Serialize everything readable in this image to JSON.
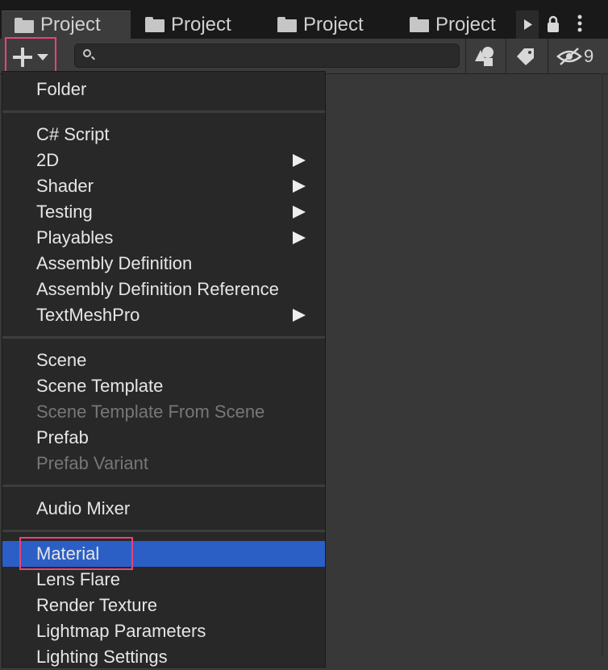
{
  "tabs": [
    {
      "label": "Project"
    },
    {
      "label": "Project"
    },
    {
      "label": "Project"
    },
    {
      "label": "Project"
    }
  ],
  "toolbar": {
    "search_value": "",
    "hidden_count": "9"
  },
  "menu": {
    "items": [
      {
        "label": "Folder",
        "enabled": true
      },
      {
        "label": "C# Script",
        "enabled": true
      },
      {
        "label": "2D",
        "enabled": true,
        "submenu": true
      },
      {
        "label": "Shader",
        "enabled": true,
        "submenu": true
      },
      {
        "label": "Testing",
        "enabled": true,
        "submenu": true
      },
      {
        "label": "Playables",
        "enabled": true,
        "submenu": true
      },
      {
        "label": "Assembly Definition",
        "enabled": true
      },
      {
        "label": "Assembly Definition Reference",
        "enabled": true
      },
      {
        "label": "TextMeshPro",
        "enabled": true,
        "submenu": true
      },
      {
        "label": "Scene",
        "enabled": true
      },
      {
        "label": "Scene Template",
        "enabled": true
      },
      {
        "label": "Scene Template From Scene",
        "enabled": false
      },
      {
        "label": "Prefab",
        "enabled": true
      },
      {
        "label": "Prefab Variant",
        "enabled": false
      },
      {
        "label": "Audio Mixer",
        "enabled": true
      },
      {
        "label": "Material",
        "enabled": true,
        "selected": true
      },
      {
        "label": "Lens Flare",
        "enabled": true
      },
      {
        "label": "Render Texture",
        "enabled": true
      },
      {
        "label": "Lightmap Parameters",
        "enabled": true
      },
      {
        "label": "Lighting Settings",
        "enabled": true
      }
    ]
  },
  "colors": {
    "highlight_box": "#e8437b",
    "selection": "#2b5fc6"
  }
}
